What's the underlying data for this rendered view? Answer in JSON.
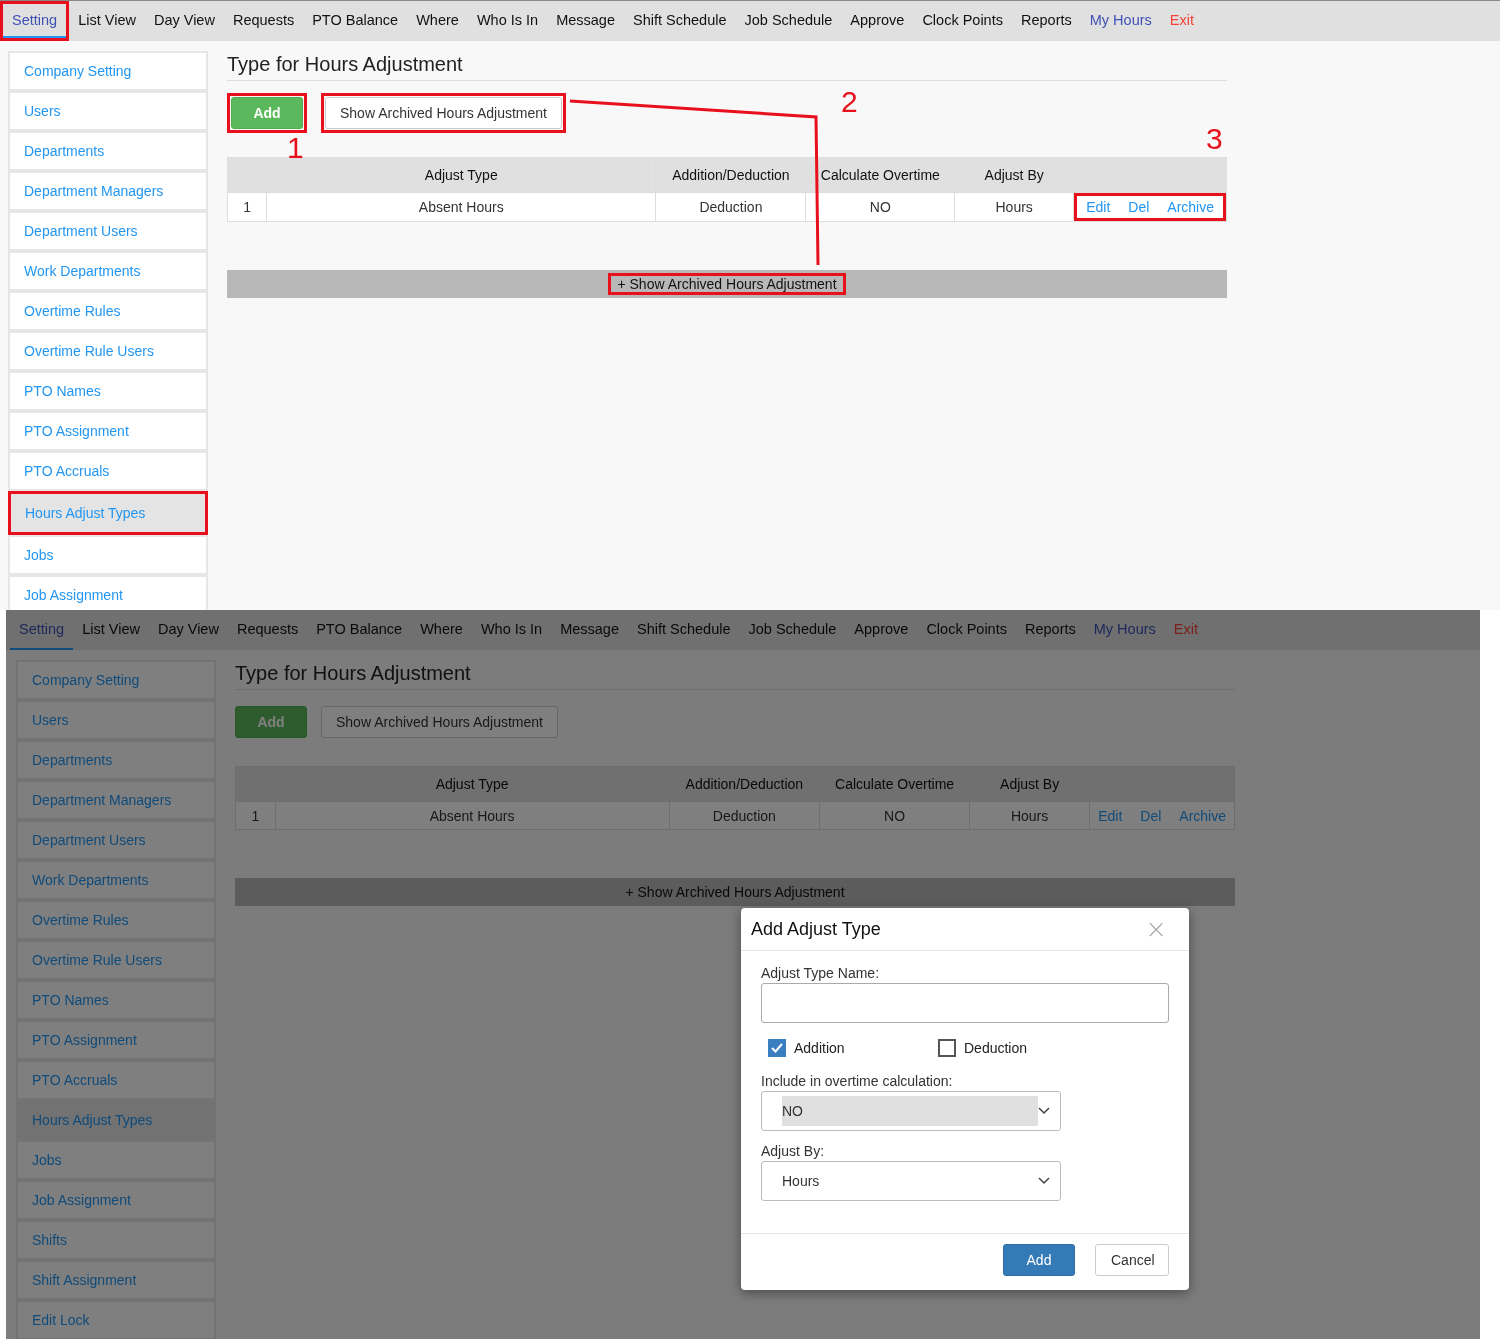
{
  "screens": [
    {
      "nav": [
        {
          "label": "Setting",
          "kind": "tab",
          "selected": true,
          "highlighted": true
        },
        {
          "label": "List View",
          "kind": "tab",
          "selected": false,
          "highlighted": false
        },
        {
          "label": "Day View",
          "kind": "tab",
          "selected": false,
          "highlighted": false
        },
        {
          "label": "Requests",
          "kind": "tab",
          "selected": false,
          "highlighted": false
        },
        {
          "label": "PTO Balance",
          "kind": "tab",
          "selected": false,
          "highlighted": false
        },
        {
          "label": "Where",
          "kind": "tab",
          "selected": false,
          "highlighted": false
        },
        {
          "label": "Who Is In",
          "kind": "tab",
          "selected": false,
          "highlighted": false
        },
        {
          "label": "Message",
          "kind": "tab",
          "selected": false,
          "highlighted": false
        },
        {
          "label": "Shift Schedule",
          "kind": "tab",
          "selected": false,
          "highlighted": false
        },
        {
          "label": "Job Schedule",
          "kind": "tab",
          "selected": false,
          "highlighted": false
        },
        {
          "label": "Approve",
          "kind": "tab",
          "selected": false,
          "highlighted": false
        },
        {
          "label": "Clock Points",
          "kind": "tab",
          "selected": false,
          "highlighted": false
        },
        {
          "label": "Reports",
          "kind": "tab",
          "selected": false,
          "highlighted": false
        },
        {
          "label": "My Hours",
          "kind": "account",
          "selected": false,
          "highlighted": false
        },
        {
          "label": "Exit",
          "kind": "exit",
          "selected": false,
          "highlighted": false
        }
      ],
      "sidebar": [
        {
          "label": "Company Setting",
          "selected": false,
          "highlighted": false
        },
        {
          "label": "Users",
          "selected": false,
          "highlighted": false
        },
        {
          "label": "Departments",
          "selected": false,
          "highlighted": false
        },
        {
          "label": "Department Managers",
          "selected": false,
          "highlighted": false
        },
        {
          "label": "Department Users",
          "selected": false,
          "highlighted": false
        },
        {
          "label": "Work Departments",
          "selected": false,
          "highlighted": false
        },
        {
          "label": "Overtime Rules",
          "selected": false,
          "highlighted": false
        },
        {
          "label": "Overtime Rule Users",
          "selected": false,
          "highlighted": false
        },
        {
          "label": "PTO Names",
          "selected": false,
          "highlighted": false
        },
        {
          "label": "PTO Assignment",
          "selected": false,
          "highlighted": false
        },
        {
          "label": "PTO Accruals",
          "selected": false,
          "highlighted": false
        },
        {
          "label": "Hours Adjust Types",
          "selected": true,
          "highlighted": true
        },
        {
          "label": "Jobs",
          "selected": false,
          "highlighted": false
        },
        {
          "label": "Job Assignment",
          "selected": false,
          "highlighted": false
        }
      ],
      "page": {
        "title": "Type for Hours Adjustment",
        "add_button": {
          "label": "Add",
          "highlighted": true
        },
        "archived_button": {
          "label": "Show Archived Hours Adjustment",
          "highlighted": true
        },
        "table": {
          "columns": [
            "Adjust Type",
            "Addition/Deduction",
            "Calculate Overtime",
            "Adjust By"
          ],
          "actions_highlighted": true,
          "rows": [
            {
              "index": "1",
              "cells": [
                "Absent Hours",
                "Deduction",
                "NO",
                "Hours"
              ],
              "actions": [
                "Edit",
                "Del",
                "Archive"
              ]
            }
          ]
        },
        "archived_bar": {
          "label": "+ Show Archived Hours Adjustment",
          "highlighted": true
        }
      },
      "connector": true,
      "annotations": [
        {
          "label": "1"
        },
        {
          "label": "2"
        },
        {
          "label": "3"
        }
      ]
    },
    {
      "nav": [
        {
          "label": "Setting",
          "kind": "tab",
          "selected": true,
          "highlighted": false
        },
        {
          "label": "List View",
          "kind": "tab",
          "selected": false,
          "highlighted": false
        },
        {
          "label": "Day View",
          "kind": "tab",
          "selected": false,
          "highlighted": false
        },
        {
          "label": "Requests",
          "kind": "tab",
          "selected": false,
          "highlighted": false
        },
        {
          "label": "PTO Balance",
          "kind": "tab",
          "selected": false,
          "highlighted": false
        },
        {
          "label": "Where",
          "kind": "tab",
          "selected": false,
          "highlighted": false
        },
        {
          "label": "Who Is In",
          "kind": "tab",
          "selected": false,
          "highlighted": false
        },
        {
          "label": "Message",
          "kind": "tab",
          "selected": false,
          "highlighted": false
        },
        {
          "label": "Shift Schedule",
          "kind": "tab",
          "selected": false,
          "highlighted": false
        },
        {
          "label": "Job Schedule",
          "kind": "tab",
          "selected": false,
          "highlighted": false
        },
        {
          "label": "Approve",
          "kind": "tab",
          "selected": false,
          "highlighted": false
        },
        {
          "label": "Clock Points",
          "kind": "tab",
          "selected": false,
          "highlighted": false
        },
        {
          "label": "Reports",
          "kind": "tab",
          "selected": false,
          "highlighted": false
        },
        {
          "label": "My Hours",
          "kind": "account",
          "selected": false,
          "highlighted": false
        },
        {
          "label": "Exit",
          "kind": "exit",
          "selected": false,
          "highlighted": false
        }
      ],
      "sidebar": [
        {
          "label": "Company Setting",
          "selected": false,
          "highlighted": false
        },
        {
          "label": "Users",
          "selected": false,
          "highlighted": false
        },
        {
          "label": "Departments",
          "selected": false,
          "highlighted": false
        },
        {
          "label": "Department Managers",
          "selected": false,
          "highlighted": false
        },
        {
          "label": "Department Users",
          "selected": false,
          "highlighted": false
        },
        {
          "label": "Work Departments",
          "selected": false,
          "highlighted": false
        },
        {
          "label": "Overtime Rules",
          "selected": false,
          "highlighted": false
        },
        {
          "label": "Overtime Rule Users",
          "selected": false,
          "highlighted": false
        },
        {
          "label": "PTO Names",
          "selected": false,
          "highlighted": false
        },
        {
          "label": "PTO Assignment",
          "selected": false,
          "highlighted": false
        },
        {
          "label": "PTO Accruals",
          "selected": false,
          "highlighted": false
        },
        {
          "label": "Hours Adjust Types",
          "selected": true,
          "highlighted": false
        },
        {
          "label": "Jobs",
          "selected": false,
          "highlighted": false
        },
        {
          "label": "Job Assignment",
          "selected": false,
          "highlighted": false
        },
        {
          "label": "Shifts",
          "selected": false,
          "highlighted": false
        },
        {
          "label": "Shift Assignment",
          "selected": false,
          "highlighted": false
        },
        {
          "label": "Edit Lock",
          "selected": false,
          "highlighted": false
        }
      ],
      "page": {
        "title": "Type for Hours Adjustment",
        "add_button": {
          "label": "Add",
          "highlighted": false
        },
        "archived_button": {
          "label": "Show Archived Hours Adjustment",
          "highlighted": false
        },
        "table": {
          "columns": [
            "Adjust Type",
            "Addition/Deduction",
            "Calculate Overtime",
            "Adjust By"
          ],
          "actions_highlighted": false,
          "rows": [
            {
              "index": "1",
              "cells": [
                "Absent Hours",
                "Deduction",
                "NO",
                "Hours"
              ],
              "actions": [
                "Edit",
                "Del",
                "Archive"
              ]
            }
          ]
        },
        "archived_bar": {
          "label": "+ Show Archived Hours Adjustment",
          "highlighted": false
        }
      },
      "dialog": {
        "title": "Add Adjust Type",
        "close": "×",
        "name_label": "Adjust Type Name:",
        "checkboxes": [
          {
            "label": "Addition",
            "checked": true
          },
          {
            "label": "Deduction",
            "checked": false
          }
        ],
        "selects": [
          {
            "label": "Include in overtime calculation:",
            "value": "NO",
            "focused": true
          },
          {
            "label": "Adjust By:",
            "value": "Hours",
            "focused": false
          }
        ],
        "buttons": [
          {
            "label": "Add",
            "kind": "primary"
          },
          {
            "label": "Cancel",
            "kind": "secondary"
          }
        ]
      }
    }
  ]
}
